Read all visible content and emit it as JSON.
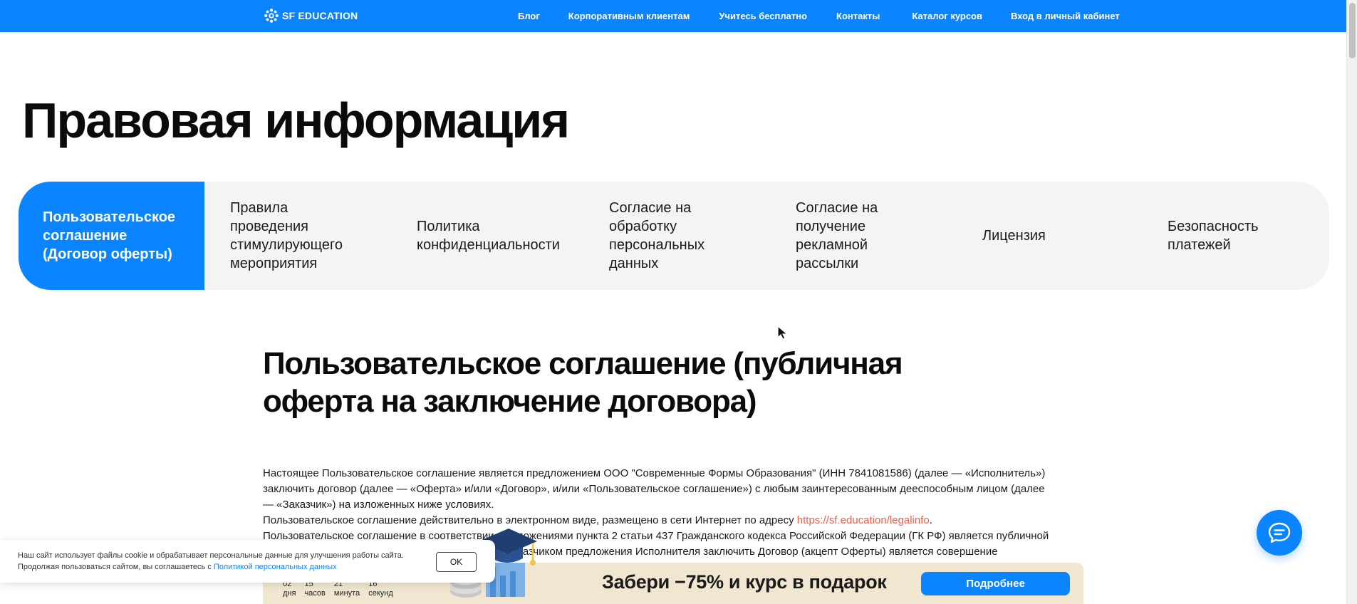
{
  "header": {
    "logo_text": "SF EDUCATION",
    "bg_color": "#0a84ff",
    "nav": [
      {
        "label": "Блог"
      },
      {
        "label": "Корпоративным клиентам"
      },
      {
        "label": "Учитесь бесплатно"
      },
      {
        "label": "Контакты"
      },
      {
        "label": "Каталог курсов"
      },
      {
        "label": "Вход в личный кабинет"
      }
    ]
  },
  "page": {
    "title": "Правовая информация"
  },
  "tabs": [
    {
      "label": "Пользовательское соглашение (Договор оферты)",
      "active": true
    },
    {
      "label": "Правила проведения стимулирующего мероприятия",
      "active": false
    },
    {
      "label": "Политика конфиденциальности",
      "active": false
    },
    {
      "label": "Согласие на обработку персональных данных",
      "active": false
    },
    {
      "label": "Согласие на получение рекламной рассылки",
      "active": false
    },
    {
      "label": "Лицензия",
      "active": false
    },
    {
      "label": "Безопасность платежей",
      "active": false
    }
  ],
  "article": {
    "title": "Пользовательское соглашение (публичная оферта на заключение договора)",
    "p1": "Настоящее Пользовательское соглашение является предложением ООО \"Современные Формы Образования\" (ИНН 7841081586) (далее — «Исполнитель») заключить договор (далее — «Оферта» и/или «Договор», и/или «Пользовательское соглашение») с любым заинтересованным дееспособным лицом (далее — «Заказчик») на изложенных ниже условиях.",
    "p2_prefix": "Пользовательское соглашение действительно в электронном виде, размещено в сети Интернет по адресу ",
    "p2_link": "https://sf.education/legalinfo",
    "p2_suffix": ".",
    "p3": "Пользовательское соглашение в соответствии с положениями пункта 2 статьи 437 Гражданского кодекса Российской Федерации (ГК РФ) является публичной офертой. Полным и безоговорочным принятием Заказчиком предложения Исполнителя заключить Договор (акцепт Оферты) является совершение"
  },
  "cookie": {
    "text": "Наш сайт использует файлы cookie и обрабатывает персональные данные для улучшения работы сайта. Продолжая пользоваться сайтом, вы соглашаетесь с ",
    "link": "Политикой персональных данных",
    "ok_label": "OK"
  },
  "promo": {
    "countdown": [
      {
        "value": "02",
        "unit": "дня"
      },
      {
        "value": "15",
        "unit": "часов"
      },
      {
        "value": "21",
        "unit": "минута"
      },
      {
        "value": "16",
        "unit": "секунд"
      }
    ],
    "text": "Забери −75% и курс в подарок",
    "button": "Подробнее",
    "bg_color": "#f1e6cf"
  },
  "icons": {
    "logo": "sf-logo-icon",
    "chat": "chat-bubble-icon",
    "cursor": "mouse-pointer-icon"
  }
}
